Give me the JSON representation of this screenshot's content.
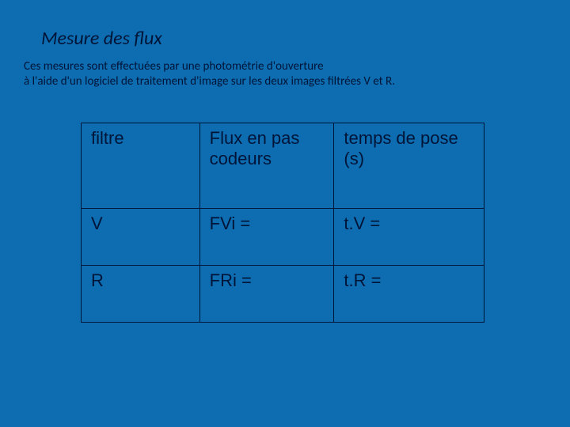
{
  "title": "Mesure des flux",
  "description_line1": "Ces mesures sont effectuées par une photométrie d'ouverture",
  "description_line2": "à l'aide d'un logiciel de traitement d'image sur les deux images filtrées V et R.",
  "table": {
    "header": {
      "col0": "filtre",
      "col1": "Flux en pas codeurs",
      "col2": "temps de pose (s)"
    },
    "rows": [
      {
        "col0": "V",
        "col1": "FVi =",
        "col2": "t.V ="
      },
      {
        "col0": "R",
        "col1": "FRi =",
        "col2": "t.R ="
      }
    ]
  }
}
